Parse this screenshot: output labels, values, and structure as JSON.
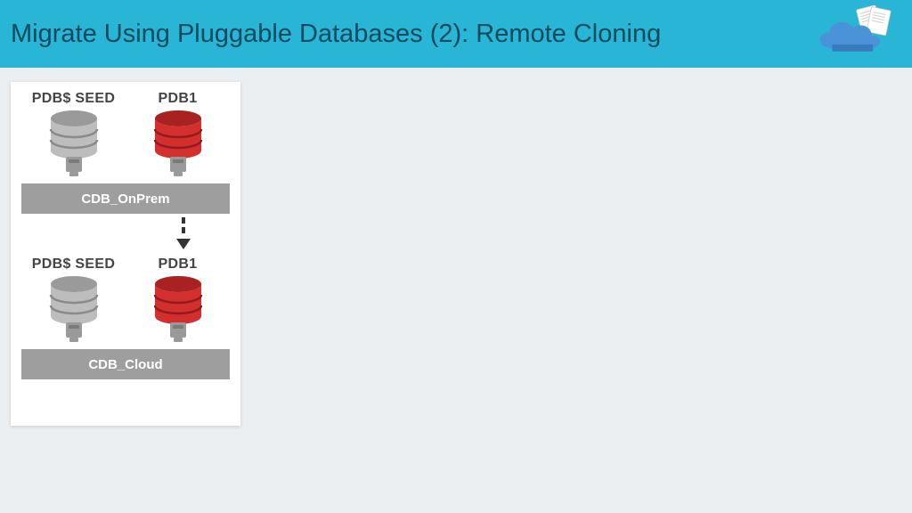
{
  "header": {
    "title": "Migrate Using Pluggable Databases (2): Remote Cloning"
  },
  "diagram": {
    "top": {
      "pdb_seed_label": "PDB$ SEED",
      "pdb1_label": "PDB1",
      "cdb_label": "CDB_OnPrem"
    },
    "bottom": {
      "pdb_seed_label": "PDB$ SEED",
      "pdb1_label": "PDB1",
      "cdb_label": "CDB_Cloud"
    }
  },
  "colors": {
    "header_bg": "#29b6d6",
    "title_text": "#0d4a5e",
    "page_bg": "#eceff1",
    "gray_db": "#bdbdbd",
    "gray_db_dark": "#9a9a9a",
    "red_db": "#d32f2f",
    "red_db_dark": "#a82222",
    "bar": "#9e9e9e"
  }
}
